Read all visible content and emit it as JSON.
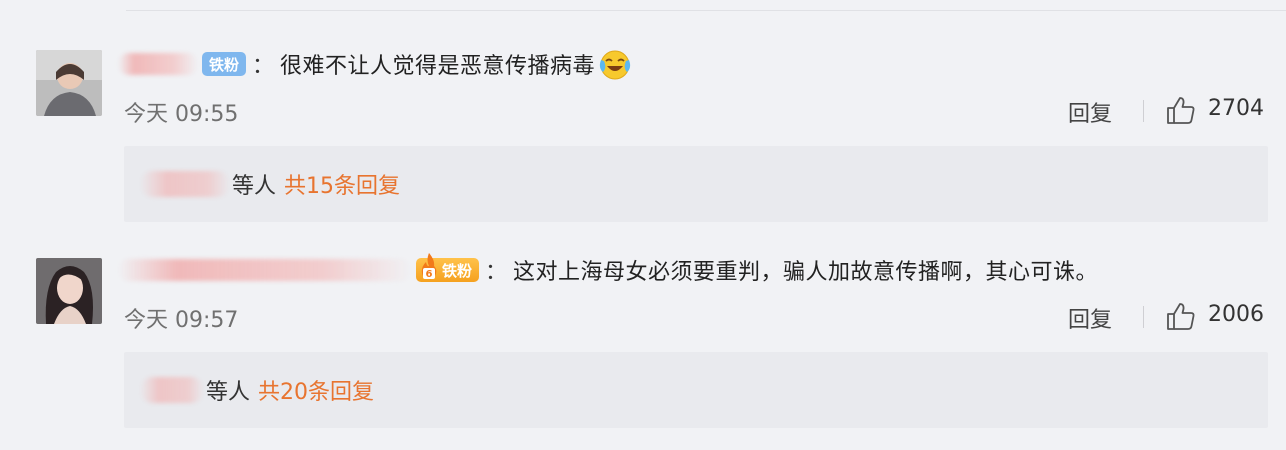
{
  "comments": [
    {
      "badge": "铁粉",
      "colon": "：",
      "text": "很难不让人觉得是恶意传播病毒",
      "emoji": "laugh-cry-emoji",
      "time": "今天 09:55",
      "reply_label": "回复",
      "likes": "2704",
      "reply_users_suffix": "等人",
      "reply_count_text": "共15条回复"
    },
    {
      "badge": "铁粉",
      "badge_level": "6",
      "colon": "：",
      "text": "这对上海母女必须要重判，骗人加故意传播啊，其心可诛。",
      "time": "今天 09:57",
      "reply_label": "回复",
      "likes": "2006",
      "reply_users_suffix": "等人",
      "reply_count_text": "共20条回复"
    }
  ],
  "colors": {
    "background": "#f1f2f5",
    "reply_box": "#e9eaee",
    "reply_count": "#e8742f",
    "badge_blue": "#7fb7ee",
    "badge_gold": "#f5a11f"
  }
}
